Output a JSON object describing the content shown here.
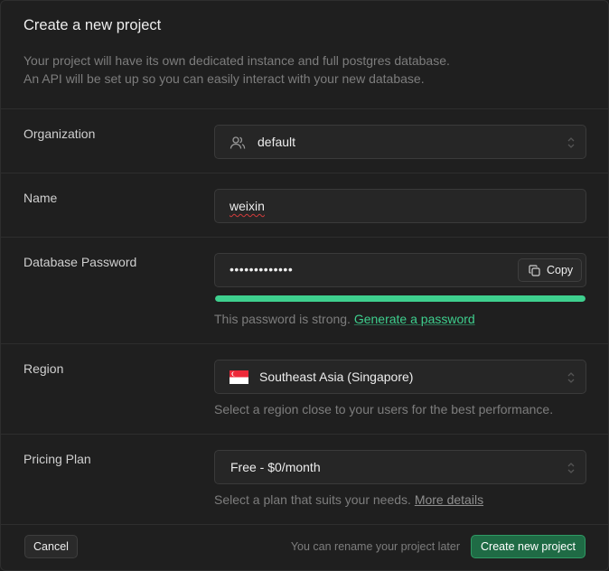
{
  "header": {
    "title": "Create a new project",
    "desc_line1": "Your project will have its own dedicated instance and full postgres database.",
    "desc_line2": "An API will be set up so you can easily interact with your new database."
  },
  "organization": {
    "label": "Organization",
    "value": "default",
    "icon": "users-icon"
  },
  "name": {
    "label": "Name",
    "value": "weixin"
  },
  "password": {
    "label": "Database Password",
    "value": "•••••••••••••",
    "copy_label": "Copy",
    "strength_fraction": 1.0,
    "strength_text": "This password is strong.",
    "generate_link": "Generate a password"
  },
  "region": {
    "label": "Region",
    "value": "Southeast Asia (Singapore)",
    "flag": "singapore-flag-icon",
    "help": "Select a region close to your users for the best performance."
  },
  "plan": {
    "label": "Pricing Plan",
    "value": "Free - $0/month",
    "help": "Select a plan that suits your needs.",
    "more_link": "More details"
  },
  "footer": {
    "cancel_label": "Cancel",
    "note": "You can rename your project later",
    "create_label": "Create new project"
  },
  "colors": {
    "accent": "#3ecf8e",
    "background": "#1f1f1f",
    "field": "#262626"
  }
}
